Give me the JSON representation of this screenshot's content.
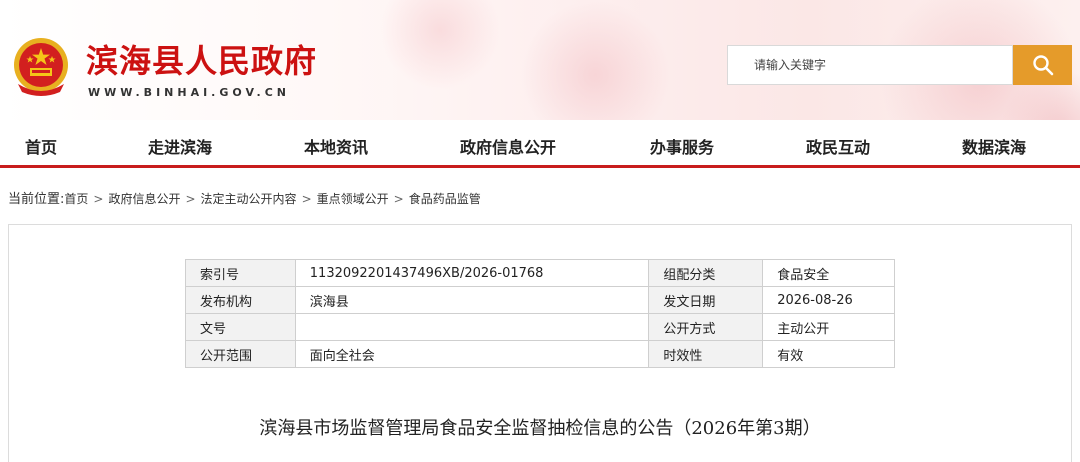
{
  "header": {
    "site_title": "滨海县人民政府",
    "site_url": "WWW.BINHAI.GOV.CN",
    "emblem_icon": "national-emblem-icon",
    "search": {
      "placeholder": "请输入关键字",
      "value": "",
      "icon": "search-icon",
      "button_color": "#e59b2a"
    }
  },
  "nav": {
    "items": [
      {
        "label": "首页"
      },
      {
        "label": "走进滨海"
      },
      {
        "label": "本地资讯"
      },
      {
        "label": "政府信息公开"
      },
      {
        "label": "办事服务"
      },
      {
        "label": "政民互动"
      },
      {
        "label": "数据滨海"
      }
    ],
    "accent_color": "#c81d1d"
  },
  "breadcrumb": {
    "lead": "当前位置:",
    "items": [
      "首页",
      "政府信息公开",
      "法定主动公开内容",
      "重点领域公开",
      "食品药品监管"
    ],
    "separator": ">"
  },
  "meta": {
    "rows": [
      [
        {
          "label": "索引号",
          "value": "1132092201437496XB/2026-01768"
        },
        {
          "label": "组配分类",
          "value": "食品安全"
        }
      ],
      [
        {
          "label": "发布机构",
          "value": "滨海县"
        },
        {
          "label": "发文日期",
          "value": "2026-08-26"
        }
      ],
      [
        {
          "label": "文号",
          "value": ""
        },
        {
          "label": "公开方式",
          "value": "主动公开"
        }
      ],
      [
        {
          "label": "公开范围",
          "value": "面向全社会"
        },
        {
          "label": "时效性",
          "value": "有效"
        }
      ]
    ]
  },
  "document": {
    "title": "滨海县市场监督管理局食品安全监督抽检信息的公告（2026年第3期）"
  }
}
